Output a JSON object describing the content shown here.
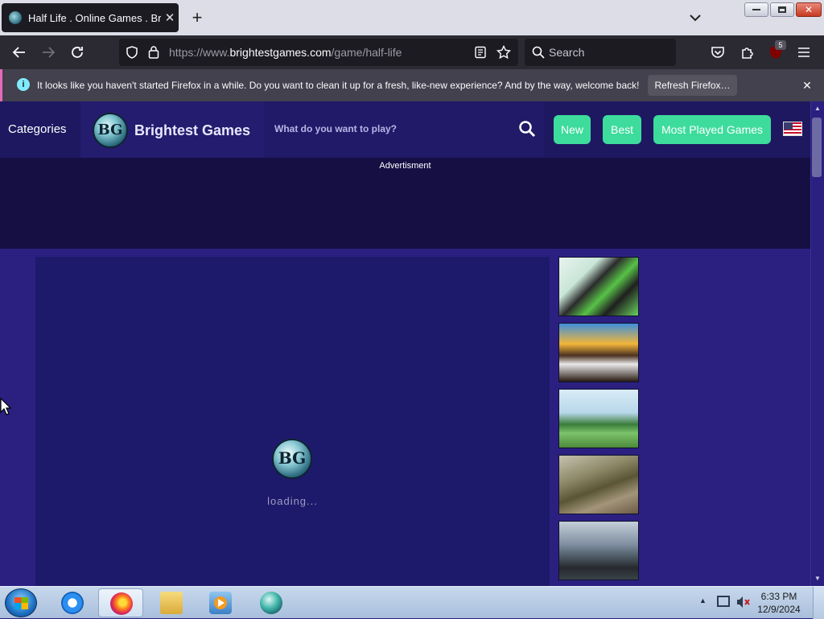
{
  "browser": {
    "tab_title": "Half Life . Online Games . Bright",
    "url_prefix": "https://www.",
    "url_domain": "brightestgames.com",
    "url_path": "/game/half-life",
    "search_placeholder": "Search",
    "extensions_badge": "5"
  },
  "notification": {
    "message": "It looks like you haven't started Firefox in a while. Do you want to clean it up for a fresh, like-new experience? And by the way, welcome back!",
    "button_label": "Refresh Firefox…",
    "close_glyph": "✕"
  },
  "site": {
    "categories_label": "Categories",
    "logo_text": "BG",
    "name": "Brightest Games",
    "search_placeholder": "What do you want to play?",
    "nav": [
      "New",
      "Best",
      "Most Played Games"
    ],
    "accent_color": "#3ddc9c",
    "header_color": "#1d1860",
    "page_bg": "#2b2080"
  },
  "ad": {
    "label": "Advertisment"
  },
  "game": {
    "loading_text": "loading..."
  },
  "related_games": [
    {
      "icon": "ben10-thumbnail"
    },
    {
      "icon": "jungle-panda-thumbnail"
    },
    {
      "icon": "warrior-forest-thumbnail"
    },
    {
      "icon": "tank-thumbnail"
    },
    {
      "icon": "soldier-shooter-thumbnail"
    }
  ],
  "taskbar": {
    "apps": [
      "internet-explorer",
      "firefox",
      "file-explorer",
      "media-player",
      "brightest-games"
    ],
    "time": "6:33 PM",
    "date": "12/9/2024"
  }
}
